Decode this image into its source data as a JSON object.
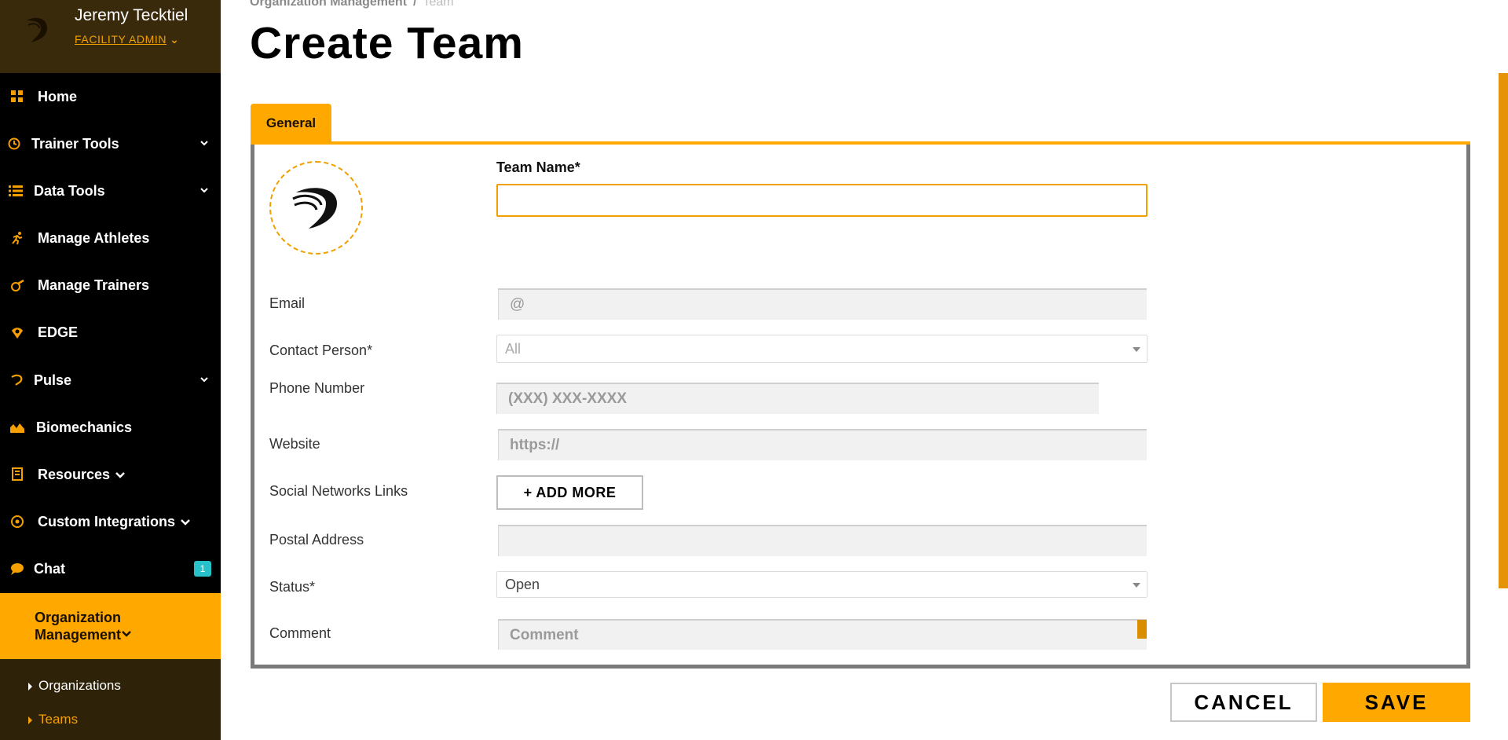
{
  "user": {
    "name": "Jeremy Tecktiel",
    "role": "FACILITY ADMIN"
  },
  "nav": {
    "home": "Home",
    "trainer_tools": "Trainer Tools",
    "data_tools": "Data Tools",
    "manage_athletes": "Manage Athletes",
    "manage_trainers": "Manage Trainers",
    "edge": "EDGE",
    "pulse": "Pulse",
    "biomechanics": "Biomechanics",
    "resources": "Resources",
    "custom_integrations": "Custom Integrations",
    "chat": "Chat",
    "chat_badge": "1",
    "org_management_line1": "Organization",
    "org_management_line2": "Management",
    "sub_organizations": "Organizations",
    "sub_teams": "Teams"
  },
  "breadcrumb": {
    "parent": "Organization Management",
    "separator": "/",
    "current": "Team"
  },
  "page_title": "Create Team",
  "tabs": {
    "general": "General"
  },
  "form": {
    "team_name_label": "Team Name*",
    "team_name_value": "",
    "email_label": "Email",
    "email_placeholder": "@",
    "contact_label": "Contact Person*",
    "contact_value": "All",
    "phone_label": "Phone Number",
    "phone_placeholder": "(XXX) XXX-XXXX",
    "website_label": "Website",
    "website_placeholder": "https://",
    "social_label": "Social Networks Links",
    "add_more_label": "+ ADD MORE",
    "postal_label": "Postal Address",
    "postal_value": "",
    "status_label": "Status*",
    "status_value": "Open",
    "comment_label": "Comment",
    "comment_placeholder": "Comment"
  },
  "actions": {
    "cancel": "CANCEL",
    "save": "SAVE"
  },
  "colors": {
    "accent": "#ffa800",
    "sidebar_bg": "#000000",
    "user_block_bg": "#3a2a0c",
    "badge": "#26c1c9"
  },
  "icons": {
    "home": "grid-icon",
    "trainer_tools": "clock-icon",
    "data_tools": "list-icon",
    "manage_athletes": "runner-icon",
    "manage_trainers": "whistle-icon",
    "edge": "edge-icon",
    "pulse": "pulse-icon",
    "biomechanics": "area-chart-icon",
    "resources": "book-icon",
    "custom_integrations": "target-icon",
    "chat": "chat-bubble-icon"
  }
}
